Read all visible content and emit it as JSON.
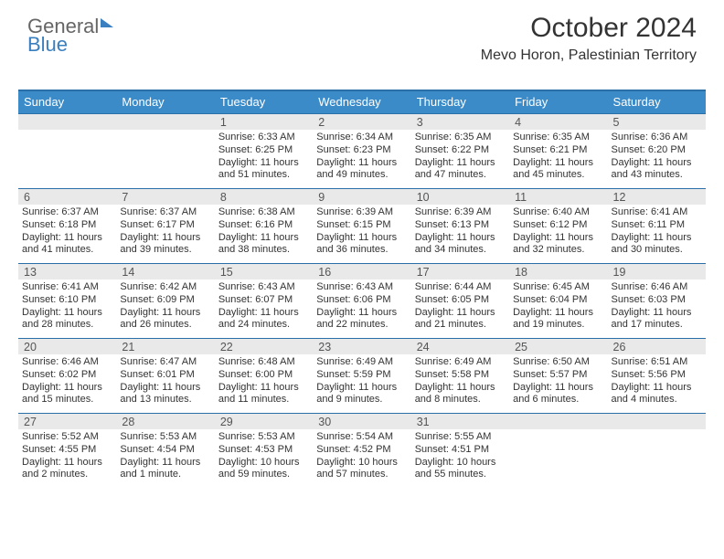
{
  "logo": {
    "line1": "General",
    "line2": "Blue"
  },
  "header": {
    "month_title": "October 2024",
    "location": "Mevo Horon, Palestinian Territory"
  },
  "weekdays": [
    "Sunday",
    "Monday",
    "Tuesday",
    "Wednesday",
    "Thursday",
    "Friday",
    "Saturday"
  ],
  "weeks": [
    {
      "nums": [
        "",
        "",
        "1",
        "2",
        "3",
        "4",
        "5"
      ],
      "cells": [
        {
          "sunrise": "",
          "sunset": "",
          "daylight": ""
        },
        {
          "sunrise": "",
          "sunset": "",
          "daylight": ""
        },
        {
          "sunrise": "Sunrise: 6:33 AM",
          "sunset": "Sunset: 6:25 PM",
          "daylight": "Daylight: 11 hours and 51 minutes."
        },
        {
          "sunrise": "Sunrise: 6:34 AM",
          "sunset": "Sunset: 6:23 PM",
          "daylight": "Daylight: 11 hours and 49 minutes."
        },
        {
          "sunrise": "Sunrise: 6:35 AM",
          "sunset": "Sunset: 6:22 PM",
          "daylight": "Daylight: 11 hours and 47 minutes."
        },
        {
          "sunrise": "Sunrise: 6:35 AM",
          "sunset": "Sunset: 6:21 PM",
          "daylight": "Daylight: 11 hours and 45 minutes."
        },
        {
          "sunrise": "Sunrise: 6:36 AM",
          "sunset": "Sunset: 6:20 PM",
          "daylight": "Daylight: 11 hours and 43 minutes."
        }
      ]
    },
    {
      "nums": [
        "6",
        "7",
        "8",
        "9",
        "10",
        "11",
        "12"
      ],
      "cells": [
        {
          "sunrise": "Sunrise: 6:37 AM",
          "sunset": "Sunset: 6:18 PM",
          "daylight": "Daylight: 11 hours and 41 minutes."
        },
        {
          "sunrise": "Sunrise: 6:37 AM",
          "sunset": "Sunset: 6:17 PM",
          "daylight": "Daylight: 11 hours and 39 minutes."
        },
        {
          "sunrise": "Sunrise: 6:38 AM",
          "sunset": "Sunset: 6:16 PM",
          "daylight": "Daylight: 11 hours and 38 minutes."
        },
        {
          "sunrise": "Sunrise: 6:39 AM",
          "sunset": "Sunset: 6:15 PM",
          "daylight": "Daylight: 11 hours and 36 minutes."
        },
        {
          "sunrise": "Sunrise: 6:39 AM",
          "sunset": "Sunset: 6:13 PM",
          "daylight": "Daylight: 11 hours and 34 minutes."
        },
        {
          "sunrise": "Sunrise: 6:40 AM",
          "sunset": "Sunset: 6:12 PM",
          "daylight": "Daylight: 11 hours and 32 minutes."
        },
        {
          "sunrise": "Sunrise: 6:41 AM",
          "sunset": "Sunset: 6:11 PM",
          "daylight": "Daylight: 11 hours and 30 minutes."
        }
      ]
    },
    {
      "nums": [
        "13",
        "14",
        "15",
        "16",
        "17",
        "18",
        "19"
      ],
      "cells": [
        {
          "sunrise": "Sunrise: 6:41 AM",
          "sunset": "Sunset: 6:10 PM",
          "daylight": "Daylight: 11 hours and 28 minutes."
        },
        {
          "sunrise": "Sunrise: 6:42 AM",
          "sunset": "Sunset: 6:09 PM",
          "daylight": "Daylight: 11 hours and 26 minutes."
        },
        {
          "sunrise": "Sunrise: 6:43 AM",
          "sunset": "Sunset: 6:07 PM",
          "daylight": "Daylight: 11 hours and 24 minutes."
        },
        {
          "sunrise": "Sunrise: 6:43 AM",
          "sunset": "Sunset: 6:06 PM",
          "daylight": "Daylight: 11 hours and 22 minutes."
        },
        {
          "sunrise": "Sunrise: 6:44 AM",
          "sunset": "Sunset: 6:05 PM",
          "daylight": "Daylight: 11 hours and 21 minutes."
        },
        {
          "sunrise": "Sunrise: 6:45 AM",
          "sunset": "Sunset: 6:04 PM",
          "daylight": "Daylight: 11 hours and 19 minutes."
        },
        {
          "sunrise": "Sunrise: 6:46 AM",
          "sunset": "Sunset: 6:03 PM",
          "daylight": "Daylight: 11 hours and 17 minutes."
        }
      ]
    },
    {
      "nums": [
        "20",
        "21",
        "22",
        "23",
        "24",
        "25",
        "26"
      ],
      "cells": [
        {
          "sunrise": "Sunrise: 6:46 AM",
          "sunset": "Sunset: 6:02 PM",
          "daylight": "Daylight: 11 hours and 15 minutes."
        },
        {
          "sunrise": "Sunrise: 6:47 AM",
          "sunset": "Sunset: 6:01 PM",
          "daylight": "Daylight: 11 hours and 13 minutes."
        },
        {
          "sunrise": "Sunrise: 6:48 AM",
          "sunset": "Sunset: 6:00 PM",
          "daylight": "Daylight: 11 hours and 11 minutes."
        },
        {
          "sunrise": "Sunrise: 6:49 AM",
          "sunset": "Sunset: 5:59 PM",
          "daylight": "Daylight: 11 hours and 9 minutes."
        },
        {
          "sunrise": "Sunrise: 6:49 AM",
          "sunset": "Sunset: 5:58 PM",
          "daylight": "Daylight: 11 hours and 8 minutes."
        },
        {
          "sunrise": "Sunrise: 6:50 AM",
          "sunset": "Sunset: 5:57 PM",
          "daylight": "Daylight: 11 hours and 6 minutes."
        },
        {
          "sunrise": "Sunrise: 6:51 AM",
          "sunset": "Sunset: 5:56 PM",
          "daylight": "Daylight: 11 hours and 4 minutes."
        }
      ]
    },
    {
      "nums": [
        "27",
        "28",
        "29",
        "30",
        "31",
        "",
        ""
      ],
      "cells": [
        {
          "sunrise": "Sunrise: 5:52 AM",
          "sunset": "Sunset: 4:55 PM",
          "daylight": "Daylight: 11 hours and 2 minutes."
        },
        {
          "sunrise": "Sunrise: 5:53 AM",
          "sunset": "Sunset: 4:54 PM",
          "daylight": "Daylight: 11 hours and 1 minute."
        },
        {
          "sunrise": "Sunrise: 5:53 AM",
          "sunset": "Sunset: 4:53 PM",
          "daylight": "Daylight: 10 hours and 59 minutes."
        },
        {
          "sunrise": "Sunrise: 5:54 AM",
          "sunset": "Sunset: 4:52 PM",
          "daylight": "Daylight: 10 hours and 57 minutes."
        },
        {
          "sunrise": "Sunrise: 5:55 AM",
          "sunset": "Sunset: 4:51 PM",
          "daylight": "Daylight: 10 hours and 55 minutes."
        },
        {
          "sunrise": "",
          "sunset": "",
          "daylight": ""
        },
        {
          "sunrise": "",
          "sunset": "",
          "daylight": ""
        }
      ]
    }
  ]
}
